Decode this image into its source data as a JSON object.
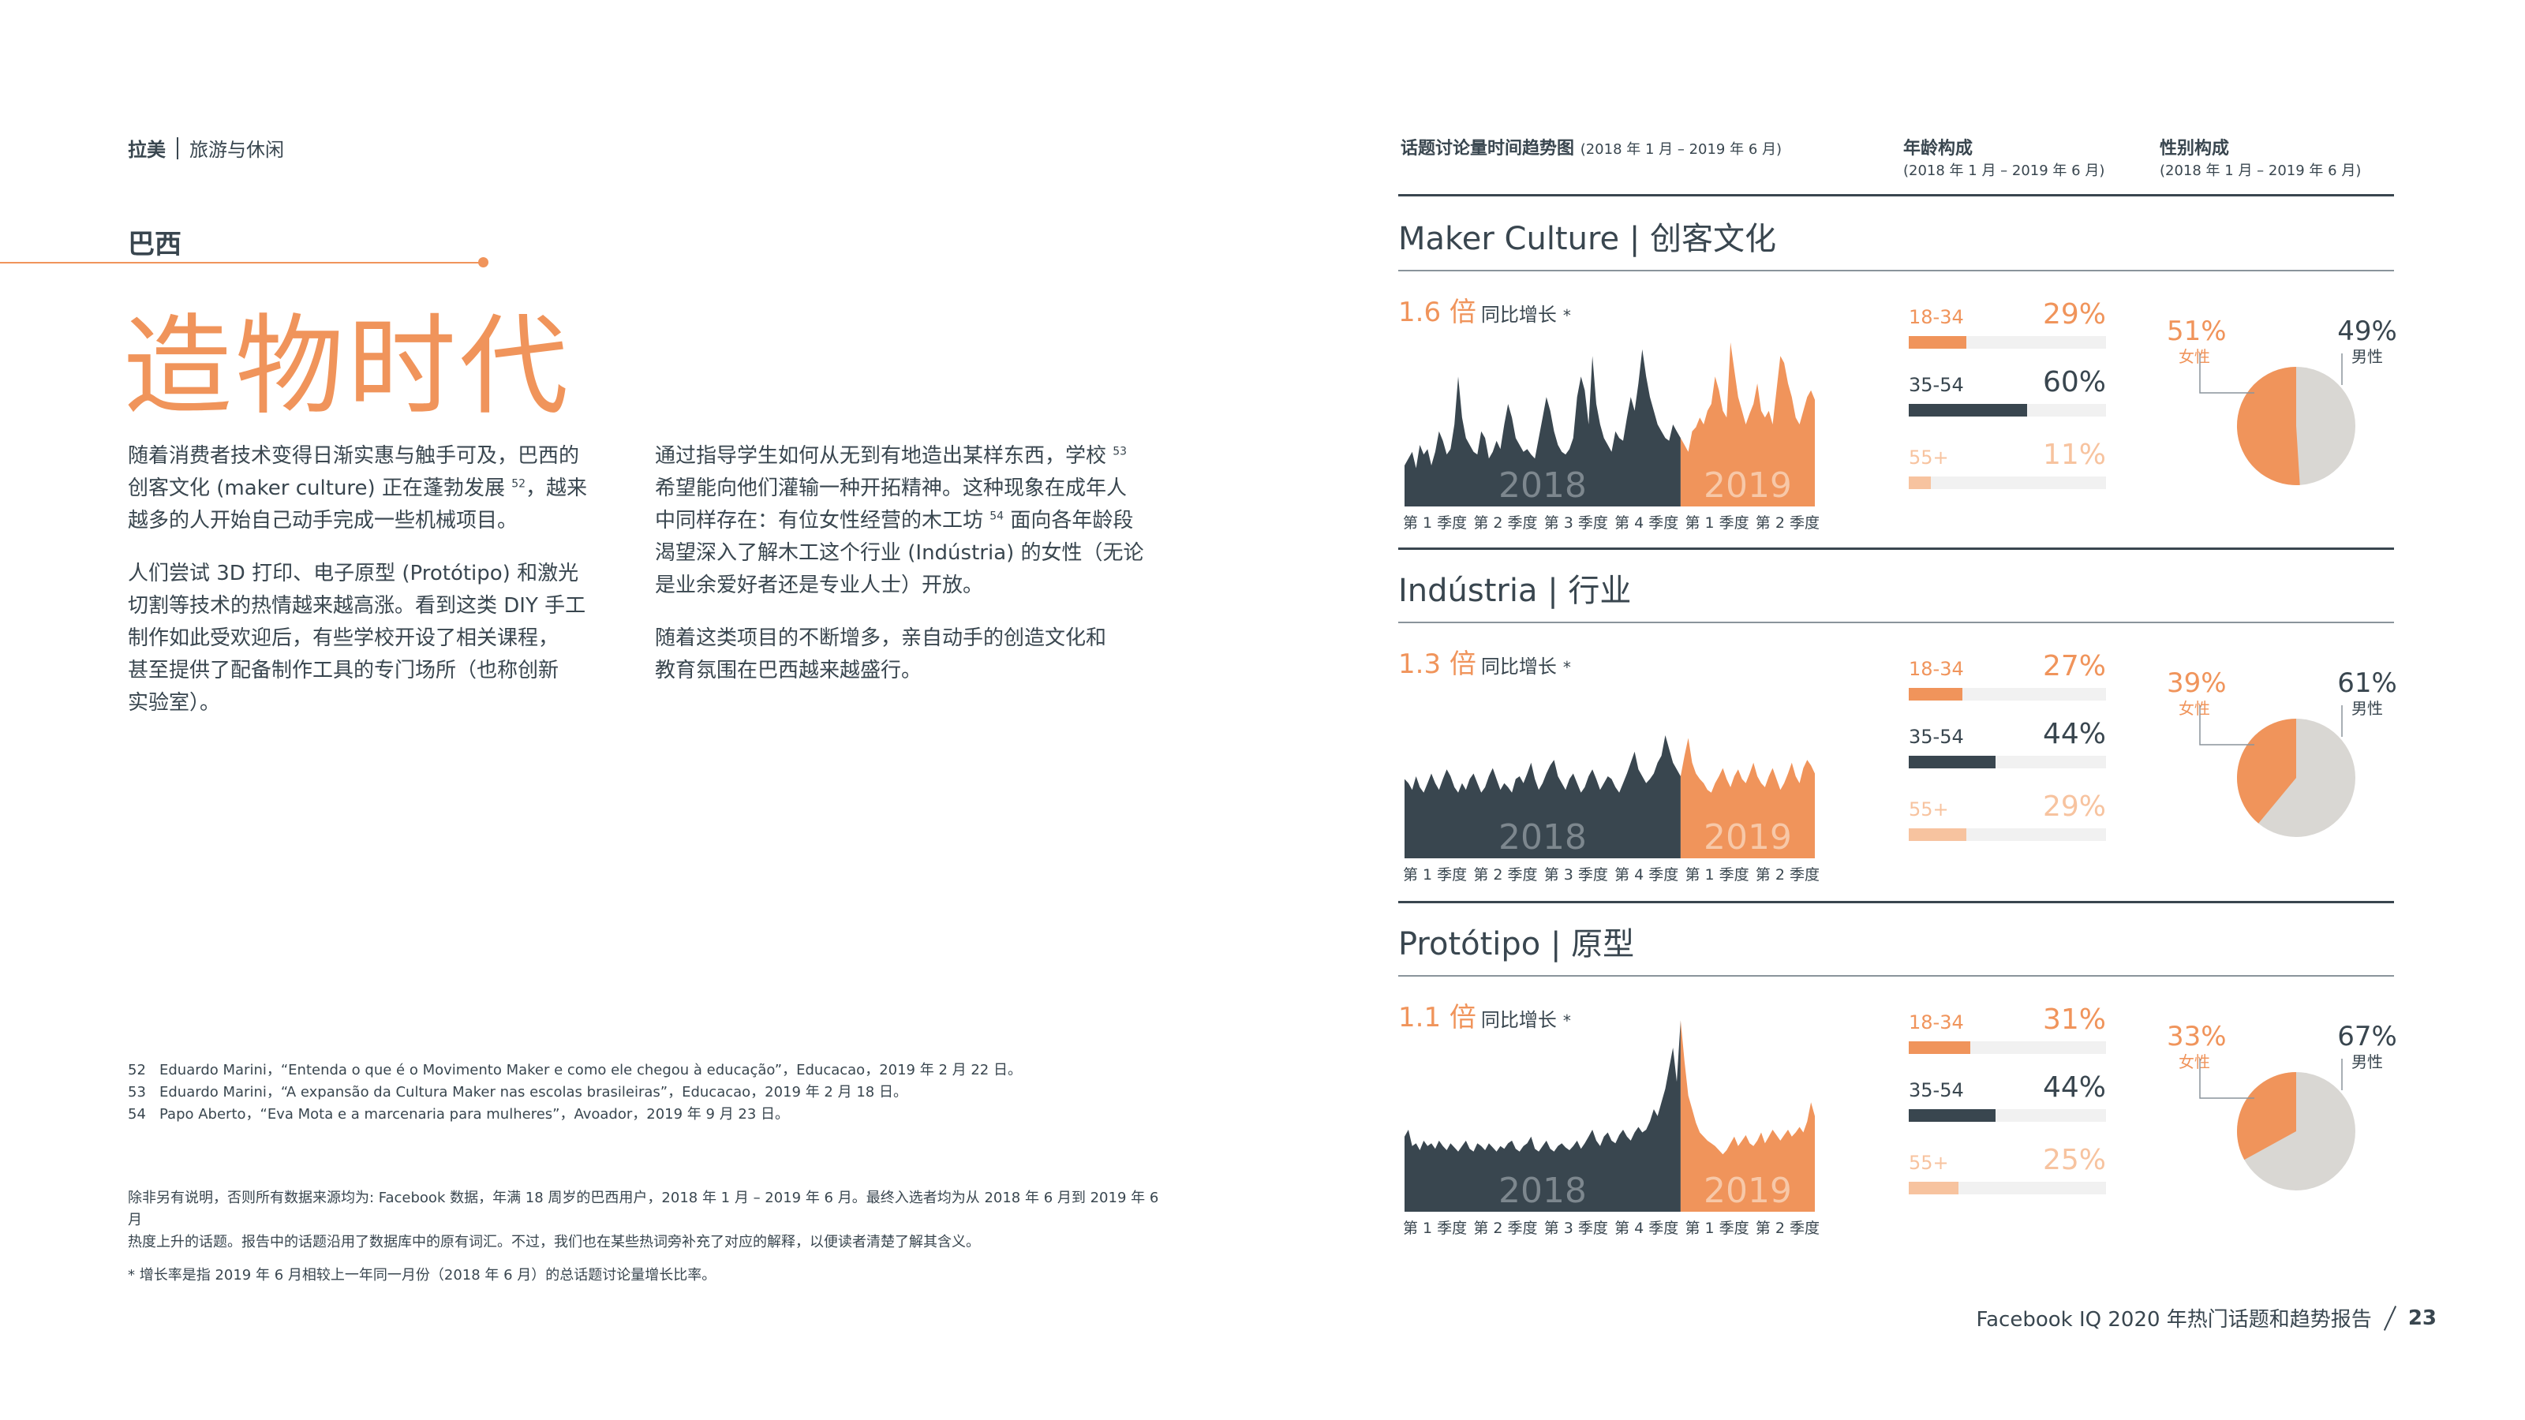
{
  "header": {
    "region": "拉美",
    "category": "旅游与休闲"
  },
  "country": "巴西",
  "headline": "造物时代",
  "body": {
    "col1_p1": [
      "随着消费者技术变得日渐实惠与触手可及，巴西的",
      "创客文化 (maker culture) 正在蓬勃发展 ",
      "52",
      "，越来",
      "越多的人开始自己动手完成一些机械项目。"
    ],
    "col1_p2": [
      "人们尝试 3D 打印、电子原型 (Protótipo) 和激光",
      "切割等技术的热情越来越高涨。看到这类 DIY 手工",
      "制作如此受欢迎后，有些学校开设了相关课程，",
      "甚至提供了配备制作工具的专门场所（也称创新",
      "实验室）。"
    ],
    "col2_p1": [
      "通过指导学生如何从无到有地造出某样东西，学校 ",
      "53",
      "希望能向他们灌输一种开拓精神。这种现象在成年人",
      "中同样存在：有位女性经营的木工坊 ",
      "54",
      " 面向各年龄段",
      "渴望深入了解木工这个行业 (Indústria) 的女性（无论",
      "是业余爱好者还是专业人士）开放。"
    ],
    "col2_p2": [
      "随着这类项目的不断增多，亲自动手的创造文化和",
      "教育氛围在巴西越来越盛行。"
    ]
  },
  "footnotes": [
    {
      "num": "52",
      "text": "Eduardo Marini，“Entenda o que é o Movimento Maker e como ele chegou à educação”，Educacao，2019 年 2 月 22 日。"
    },
    {
      "num": "53",
      "text": "Eduardo Marini，“A expansão da Cultura Maker nas escolas brasileiras”，Educacao，2019 年 2 月 18 日。"
    },
    {
      "num": "54",
      "text": "Papo Aberto，“Eva Mota e a marcenaria para mulheres”，Avoador，2019 年 9 月 23 日。"
    }
  ],
  "disclaimer": {
    "line1": "除非另有说明，否则所有数据来源均为: Facebook 数据，年满 18 周岁的巴西用户，2018 年 1 月 – 2019 年 6 月。最终入选者均为从 2018 年 6 月到 2019 年 6 月",
    "line2": "热度上升的话题。报告中的话题沿用了数据库中的原有词汇。不过，我们也在某些热词旁补充了对应的解释，以便读者清楚了解其含义。",
    "line3": "* 增长率是指 2019 年 6 月相较上一年同一月份（2018 年 6 月）的总话题讨论量增长比率。"
  },
  "column_headers": {
    "trend_title": "话题讨论量时间趋势图",
    "trend_range": "(2018 年 1 月 – 2019 年 6 月)",
    "age_title": "年龄构成",
    "age_range": "(2018 年 1 月 – 2019 年 6 月)",
    "gender_title": "性别构成",
    "gender_range": "(2018 年 1 月 – 2019 年 6 月)"
  },
  "colors": {
    "dark": "#39464f",
    "orange": "#f0945b",
    "light_orange": "#f7c39f",
    "gray": "#d9d7d3"
  },
  "chart_data": [
    {
      "type": "area",
      "topic": "Maker Culture | 创客文化",
      "growth": "1.6 倍",
      "growth_text": "同比增长",
      "growth_mark": "*",
      "year_labels": [
        "2018",
        "2019"
      ],
      "quarters": [
        "第 1 季度",
        "第 2 季度",
        "第 3 季度",
        "第 4 季度",
        "第 1 季度",
        "第 2 季度"
      ],
      "trend": [
        30,
        35,
        40,
        28,
        45,
        38,
        42,
        30,
        40,
        55,
        48,
        38,
        42,
        60,
        95,
        65,
        50,
        45,
        40,
        38,
        55,
        50,
        35,
        40,
        48,
        42,
        60,
        75,
        65,
        50,
        45,
        40,
        42,
        38,
        35,
        50,
        65,
        80,
        70,
        55,
        45,
        40,
        38,
        42,
        50,
        80,
        95,
        85,
        60,
        110,
        75,
        60,
        50,
        45,
        40,
        55,
        50,
        48,
        65,
        80,
        70,
        90,
        115,
        95,
        80,
        70,
        60,
        55,
        50,
        48,
        60,
        55,
        50,
        45,
        40,
        55,
        58,
        65,
        60,
        70,
        75,
        95,
        85,
        70,
        65,
        120,
        100,
        80,
        70,
        60,
        68,
        75,
        90,
        70,
        65,
        70,
        60,
        85,
        110,
        105,
        90,
        80,
        65,
        60,
        70,
        80,
        85,
        78
      ],
      "age": [
        {
          "group": "18-34",
          "pct": "29%",
          "share": 29,
          "highlight": "orange"
        },
        {
          "group": "35-54",
          "pct": "60%",
          "share": 60,
          "highlight": "dark"
        },
        {
          "group": "55+",
          "pct": "11%",
          "share": 11,
          "highlight": "light"
        }
      ],
      "gender": {
        "female_pct": "51%",
        "female_label": "女性",
        "female_share": 51,
        "male_pct": "49%",
        "male_label": "男性",
        "male_share": 49
      }
    },
    {
      "type": "area",
      "topic": "Indústria | 行业",
      "growth": "1.3 倍",
      "growth_text": "同比增长",
      "growth_mark": "*",
      "year_labels": [
        "2018",
        "2019"
      ],
      "quarters": [
        "第 1 季度",
        "第 2 季度",
        "第 3 季度",
        "第 4 季度",
        "第 1 季度",
        "第 2 季度"
      ],
      "trend": [
        58,
        55,
        50,
        60,
        52,
        48,
        55,
        62,
        55,
        50,
        58,
        65,
        60,
        52,
        48,
        55,
        50,
        58,
        62,
        55,
        48,
        52,
        60,
        66,
        58,
        50,
        55,
        52,
        48,
        58,
        60,
        55,
        62,
        70,
        58,
        50,
        55,
        62,
        68,
        72,
        60,
        55,
        50,
        58,
        62,
        55,
        48,
        52,
        60,
        65,
        58,
        50,
        55,
        60,
        58,
        52,
        48,
        55,
        62,
        70,
        78,
        65,
        60,
        55,
        58,
        62,
        70,
        75,
        90,
        80,
        70,
        65,
        60,
        75,
        88,
        70,
        62,
        58,
        55,
        50,
        48,
        55,
        60,
        66,
        58,
        52,
        60,
        65,
        58,
        55,
        62,
        70,
        60,
        55,
        52,
        60,
        66,
        58,
        50,
        55,
        62,
        70,
        60,
        55,
        66,
        72,
        68,
        62
      ],
      "age": [
        {
          "group": "18-34",
          "pct": "27%",
          "share": 27,
          "highlight": "orange"
        },
        {
          "group": "35-54",
          "pct": "44%",
          "share": 44,
          "highlight": "dark"
        },
        {
          "group": "55+",
          "pct": "29%",
          "share": 29,
          "highlight": "light"
        }
      ],
      "gender": {
        "female_pct": "39%",
        "female_label": "女性",
        "female_share": 39,
        "male_pct": "61%",
        "male_label": "男性",
        "male_share": 61
      }
    },
    {
      "type": "area",
      "topic": "Protótipo | 原型",
      "growth": "1.1 倍",
      "growth_text": "同比增长",
      "growth_mark": "*",
      "year_labels": [
        "2018",
        "2019"
      ],
      "quarters": [
        "第 1 季度",
        "第 2 季度",
        "第 3 季度",
        "第 4 季度",
        "第 1 季度",
        "第 2 季度"
      ],
      "trend": [
        55,
        60,
        48,
        50,
        45,
        52,
        48,
        50,
        46,
        52,
        48,
        45,
        50,
        47,
        44,
        48,
        52,
        46,
        44,
        50,
        48,
        45,
        50,
        47,
        44,
        48,
        46,
        50,
        52,
        46,
        44,
        48,
        50,
        55,
        46,
        44,
        48,
        52,
        46,
        44,
        48,
        50,
        47,
        45,
        48,
        52,
        46,
        50,
        55,
        60,
        52,
        48,
        55,
        58,
        52,
        50,
        56,
        60,
        55,
        52,
        58,
        62,
        58,
        60,
        66,
        75,
        70,
        80,
        90,
        105,
        120,
        95,
        140,
        110,
        85,
        75,
        65,
        58,
        55,
        52,
        50,
        48,
        45,
        42,
        45,
        50,
        55,
        48,
        52,
        56,
        50,
        48,
        52,
        58,
        50,
        55,
        60,
        56,
        52,
        56,
        60,
        55,
        58,
        62,
        58,
        66,
        80,
        70
      ],
      "age": [
        {
          "group": "18-34",
          "pct": "31%",
          "share": 31,
          "highlight": "orange"
        },
        {
          "group": "35-54",
          "pct": "44%",
          "share": 44,
          "highlight": "dark"
        },
        {
          "group": "55+",
          "pct": "25%",
          "share": 25,
          "highlight": "light"
        }
      ],
      "gender": {
        "female_pct": "33%",
        "female_label": "女性",
        "female_share": 33,
        "male_pct": "67%",
        "male_label": "男性",
        "male_share": 67
      }
    }
  ],
  "footer": {
    "report": "Facebook IQ 2020 年热门话题和趋势报告",
    "page": "23"
  }
}
